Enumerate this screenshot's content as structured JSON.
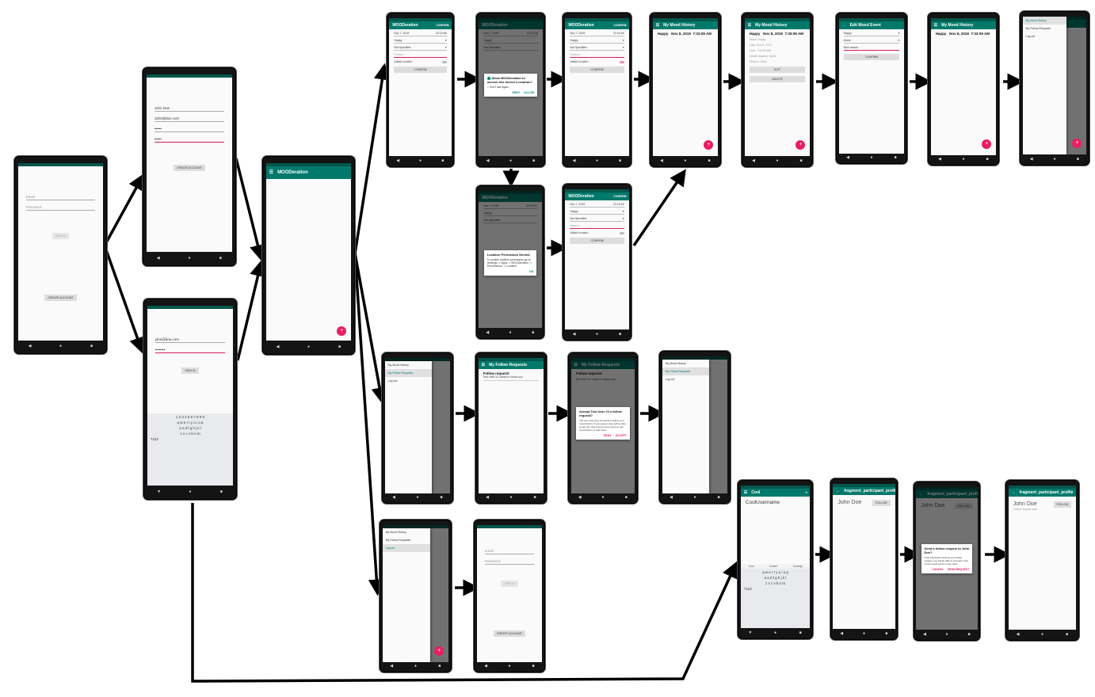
{
  "login": {
    "email_hint": "Email",
    "password_hint": "Password",
    "sign_in": "SIGN IN",
    "create_account": "CREATE ACCOUNT"
  },
  "signup": {
    "name": "John Doe",
    "email": "John@doe.com",
    "pw1": "••••••",
    "pw2": "••••••",
    "create_account": "CREATE ACCOUNT"
  },
  "signin_filled": {
    "email": "john@doe.com",
    "password": "••••••••",
    "sign_in": "SIGN IN"
  },
  "keyboard": {
    "nums": "1 2 3 4 5 6 7 8 9 0",
    "row1": "q w e r t y u i o p",
    "row2": "a s d f g h j k l",
    "row3": "z x c v b n m",
    "sym": "?123"
  },
  "app": {
    "title": "MOODeration"
  },
  "add_mood": {
    "confirm_action": "CONFIRM",
    "date": "Nov 7, 2019",
    "time": "22:10:06",
    "time2": "22:16:36",
    "mood": "Happy",
    "situation": "Not Specified",
    "reason_hint": "Reason",
    "attach_location": "Attach location",
    "confirm": "CONFIRM"
  },
  "perm": {
    "prefix": "Allow ",
    "app": "MOODeration",
    "suffix": " to access this device's location?",
    "dont_ask": "Don't ask again",
    "deny": "DENY",
    "allow": "ALLOW"
  },
  "denied": {
    "title": "Location Permission Denied",
    "body": "To enable location permission go to Settings -> Apps -> MOODeration -> Permissions -> Location",
    "ok": "OK"
  },
  "history": {
    "title": "My Mood History",
    "mood": "Happy",
    "date": "Nov 8, 2019",
    "time": "7:33:09 AM"
  },
  "detail": {
    "mood": "Mood: Happy",
    "date": "Date: Nov 8, 2019",
    "time": "Time: 7:33:09 AM",
    "social": "Social situation: Alone",
    "reason": "Reason: Work",
    "edit": "EDIT",
    "delete": "DELETE"
  },
  "edit": {
    "title": "Edit Mood Event",
    "mood": "Happy",
    "situation": "Alone",
    "reason": "New reason",
    "confirm": "CONFIRM"
  },
  "drawer": {
    "history": "My Mood History",
    "requests": "My Follow Requests",
    "logout": "Log out"
  },
  "requests": {
    "title": "My Follow Requests",
    "item": "Follow request!",
    "sub": "Test User #1 wants to follow you"
  },
  "accept": {
    "title": "Accept Test User #1's follow request?",
    "body": "The user Test User #1 wants to follow your mood history. If you accept, they will be able to see the most recent mood event of your mood history in their feed.",
    "deny": "DENY",
    "accept": "ACCEPT"
  },
  "search": {
    "query": "CoolUsername",
    "sug": [
      "Cool",
      "Cooler",
      "Cooling"
    ]
  },
  "profile": {
    "title": "fragment_participant_profile",
    "name": "John Doe",
    "follow": "FOLLOW",
    "sent": "Follow request sent"
  },
  "send": {
    "title": "Send a follow request to John Doe?",
    "body": "If the participant accepts your follow request, you will be able to see their most recent mood event in your feed.",
    "cancel": "CANCEL",
    "send": "SEND REQUEST"
  }
}
